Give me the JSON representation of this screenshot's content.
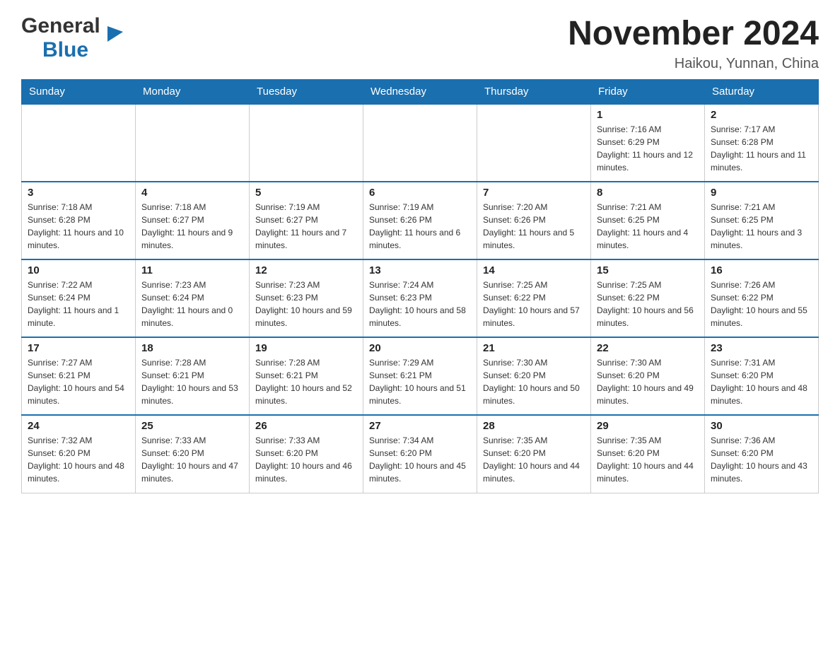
{
  "header": {
    "logo": {
      "general": "General",
      "blue": "Blue",
      "tagline": "GeneralBlue"
    },
    "title": "November 2024",
    "location": "Haikou, Yunnan, China"
  },
  "days_of_week": [
    "Sunday",
    "Monday",
    "Tuesday",
    "Wednesday",
    "Thursday",
    "Friday",
    "Saturday"
  ],
  "weeks": [
    {
      "days": [
        {
          "num": "",
          "info": ""
        },
        {
          "num": "",
          "info": ""
        },
        {
          "num": "",
          "info": ""
        },
        {
          "num": "",
          "info": ""
        },
        {
          "num": "",
          "info": ""
        },
        {
          "num": "1",
          "info": "Sunrise: 7:16 AM\nSunset: 6:29 PM\nDaylight: 11 hours and 12 minutes."
        },
        {
          "num": "2",
          "info": "Sunrise: 7:17 AM\nSunset: 6:28 PM\nDaylight: 11 hours and 11 minutes."
        }
      ]
    },
    {
      "days": [
        {
          "num": "3",
          "info": "Sunrise: 7:18 AM\nSunset: 6:28 PM\nDaylight: 11 hours and 10 minutes."
        },
        {
          "num": "4",
          "info": "Sunrise: 7:18 AM\nSunset: 6:27 PM\nDaylight: 11 hours and 9 minutes."
        },
        {
          "num": "5",
          "info": "Sunrise: 7:19 AM\nSunset: 6:27 PM\nDaylight: 11 hours and 7 minutes."
        },
        {
          "num": "6",
          "info": "Sunrise: 7:19 AM\nSunset: 6:26 PM\nDaylight: 11 hours and 6 minutes."
        },
        {
          "num": "7",
          "info": "Sunrise: 7:20 AM\nSunset: 6:26 PM\nDaylight: 11 hours and 5 minutes."
        },
        {
          "num": "8",
          "info": "Sunrise: 7:21 AM\nSunset: 6:25 PM\nDaylight: 11 hours and 4 minutes."
        },
        {
          "num": "9",
          "info": "Sunrise: 7:21 AM\nSunset: 6:25 PM\nDaylight: 11 hours and 3 minutes."
        }
      ]
    },
    {
      "days": [
        {
          "num": "10",
          "info": "Sunrise: 7:22 AM\nSunset: 6:24 PM\nDaylight: 11 hours and 1 minute."
        },
        {
          "num": "11",
          "info": "Sunrise: 7:23 AM\nSunset: 6:24 PM\nDaylight: 11 hours and 0 minutes."
        },
        {
          "num": "12",
          "info": "Sunrise: 7:23 AM\nSunset: 6:23 PM\nDaylight: 10 hours and 59 minutes."
        },
        {
          "num": "13",
          "info": "Sunrise: 7:24 AM\nSunset: 6:23 PM\nDaylight: 10 hours and 58 minutes."
        },
        {
          "num": "14",
          "info": "Sunrise: 7:25 AM\nSunset: 6:22 PM\nDaylight: 10 hours and 57 minutes."
        },
        {
          "num": "15",
          "info": "Sunrise: 7:25 AM\nSunset: 6:22 PM\nDaylight: 10 hours and 56 minutes."
        },
        {
          "num": "16",
          "info": "Sunrise: 7:26 AM\nSunset: 6:22 PM\nDaylight: 10 hours and 55 minutes."
        }
      ]
    },
    {
      "days": [
        {
          "num": "17",
          "info": "Sunrise: 7:27 AM\nSunset: 6:21 PM\nDaylight: 10 hours and 54 minutes."
        },
        {
          "num": "18",
          "info": "Sunrise: 7:28 AM\nSunset: 6:21 PM\nDaylight: 10 hours and 53 minutes."
        },
        {
          "num": "19",
          "info": "Sunrise: 7:28 AM\nSunset: 6:21 PM\nDaylight: 10 hours and 52 minutes."
        },
        {
          "num": "20",
          "info": "Sunrise: 7:29 AM\nSunset: 6:21 PM\nDaylight: 10 hours and 51 minutes."
        },
        {
          "num": "21",
          "info": "Sunrise: 7:30 AM\nSunset: 6:20 PM\nDaylight: 10 hours and 50 minutes."
        },
        {
          "num": "22",
          "info": "Sunrise: 7:30 AM\nSunset: 6:20 PM\nDaylight: 10 hours and 49 minutes."
        },
        {
          "num": "23",
          "info": "Sunrise: 7:31 AM\nSunset: 6:20 PM\nDaylight: 10 hours and 48 minutes."
        }
      ]
    },
    {
      "days": [
        {
          "num": "24",
          "info": "Sunrise: 7:32 AM\nSunset: 6:20 PM\nDaylight: 10 hours and 48 minutes."
        },
        {
          "num": "25",
          "info": "Sunrise: 7:33 AM\nSunset: 6:20 PM\nDaylight: 10 hours and 47 minutes."
        },
        {
          "num": "26",
          "info": "Sunrise: 7:33 AM\nSunset: 6:20 PM\nDaylight: 10 hours and 46 minutes."
        },
        {
          "num": "27",
          "info": "Sunrise: 7:34 AM\nSunset: 6:20 PM\nDaylight: 10 hours and 45 minutes."
        },
        {
          "num": "28",
          "info": "Sunrise: 7:35 AM\nSunset: 6:20 PM\nDaylight: 10 hours and 44 minutes."
        },
        {
          "num": "29",
          "info": "Sunrise: 7:35 AM\nSunset: 6:20 PM\nDaylight: 10 hours and 44 minutes."
        },
        {
          "num": "30",
          "info": "Sunrise: 7:36 AM\nSunset: 6:20 PM\nDaylight: 10 hours and 43 minutes."
        }
      ]
    }
  ]
}
